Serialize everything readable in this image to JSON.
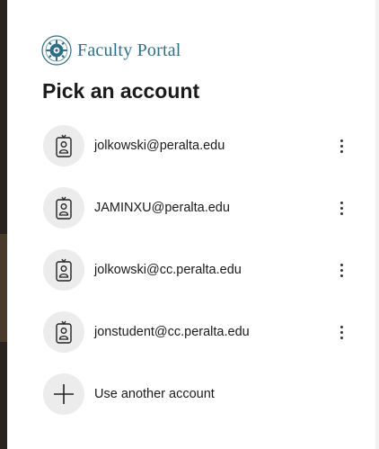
{
  "brand": {
    "name": "Faculty Portal",
    "logo_icon": "college-seal-icon",
    "accent_color": "#2f6f86"
  },
  "title": "Pick an account",
  "accounts": [
    {
      "email": "jolkowski@peralta.edu",
      "avatar_icon": "id-badge-icon"
    },
    {
      "email": "JAMINXU@peralta.edu",
      "avatar_icon": "id-badge-icon"
    },
    {
      "email": "jolkowski@cc.peralta.edu",
      "avatar_icon": "id-badge-icon"
    },
    {
      "email": "jonstudent@cc.peralta.edu",
      "avatar_icon": "id-badge-icon"
    }
  ],
  "more_options_icon": "more-vertical-icon",
  "add_account": {
    "label": "Use another account",
    "icon": "plus-icon"
  }
}
